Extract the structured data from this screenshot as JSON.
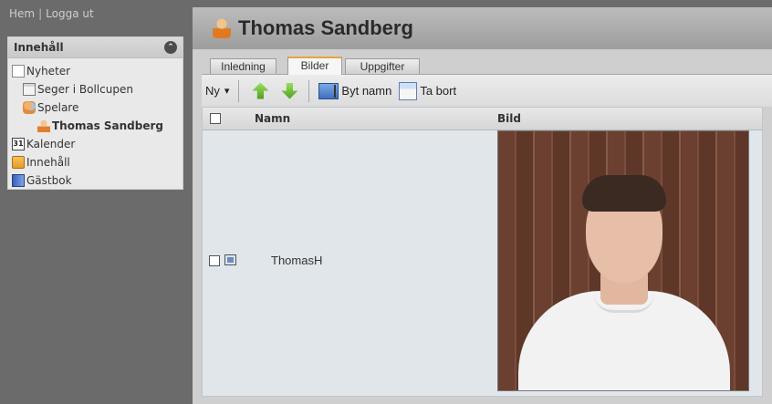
{
  "top_nav": {
    "home": "Hem",
    "separator": "|",
    "logout": "Logga ut"
  },
  "sidebar": {
    "header": "Innehåll",
    "collapse_icon": "collapse-icon",
    "items": [
      {
        "label": "Nyheter",
        "icon": "document-icon",
        "level": 0
      },
      {
        "label": "Seger i Bollcupen",
        "icon": "page-icon",
        "level": 1
      },
      {
        "label": "Spelare",
        "icon": "users-icon",
        "level": 1
      },
      {
        "label": "Thomas Sandberg",
        "icon": "user-icon",
        "level": 2,
        "selected": true
      },
      {
        "label": "Kalender",
        "icon": "calendar-icon",
        "level": 0,
        "icon_text": "31"
      },
      {
        "label": "Innehåll",
        "icon": "box-icon",
        "level": 0
      },
      {
        "label": "Gästbok",
        "icon": "guestbook-icon",
        "level": 0
      }
    ]
  },
  "main": {
    "title": "Thomas Sandberg",
    "title_icon": "user-icon",
    "tabs": [
      {
        "label": "Inledning",
        "active": false
      },
      {
        "label": "Bilder",
        "active": true
      },
      {
        "label": "Uppgifter",
        "active": false
      }
    ],
    "toolbar": {
      "new": "Ny",
      "new_caret": "▾",
      "move_up_icon": "arrow-up-icon",
      "move_down_icon": "arrow-down-icon",
      "rename": "Byt namn",
      "delete": "Ta bort"
    },
    "grid": {
      "columns": {
        "name": "Namn",
        "image": "Bild"
      },
      "rows": [
        {
          "name": "ThomasH",
          "icon": "image-icon"
        }
      ]
    }
  },
  "colors": {
    "accent_tab": "#e8a33a",
    "sidebar_bg": "#e9e9e9",
    "page_bg": "#6b6b6b"
  }
}
